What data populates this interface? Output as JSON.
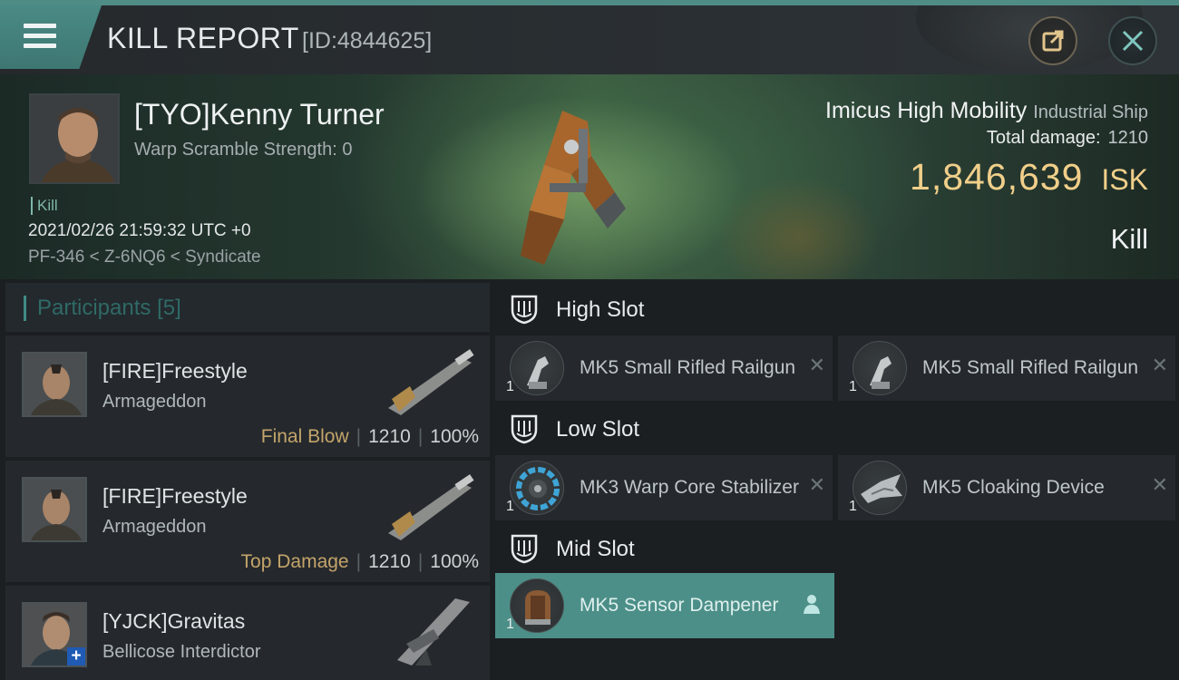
{
  "header": {
    "title": "KILL REPORT",
    "report_id": "[ID:4844625]"
  },
  "victim": {
    "name": "[TYO]Kenny Turner",
    "warp_scramble": "Warp Scramble Strength: 0",
    "tag": "Kill",
    "timestamp": "2021/02/26 21:59:32 UTC +0",
    "location": "PF-346 < Z-6NQ6 < Syndicate"
  },
  "ship": {
    "name": "Imicus High Mobility",
    "class": "Industrial Ship",
    "total_damage_label": "Total damage:",
    "total_damage": "1210",
    "isk_value": "1,846,639",
    "isk_unit": "ISK",
    "result": "Kill"
  },
  "participants": {
    "label": "Participants",
    "count": "[5]",
    "items": [
      {
        "name": "[FIRE]Freestyle",
        "ship": "Armageddon",
        "tag": "Final Blow",
        "damage": "1210",
        "percent": "100%"
      },
      {
        "name": "[FIRE]Freestyle",
        "ship": "Armageddon",
        "tag": "Top Damage",
        "damage": "1210",
        "percent": "100%"
      },
      {
        "name": "[YJCK]Gravitas",
        "ship": "Bellicose Interdictor",
        "tag": "",
        "damage": "",
        "percent": ""
      }
    ]
  },
  "slots": {
    "high": {
      "label": "High Slot",
      "modules": [
        {
          "name": "MK5 Small Rifled Railgun",
          "qty": "1",
          "icon": "railgun-icon"
        },
        {
          "name": "MK5 Small Rifled Railgun",
          "qty": "1",
          "icon": "railgun-icon"
        }
      ]
    },
    "low": {
      "label": "Low Slot",
      "modules": [
        {
          "name": "MK3 Warp Core Stabilizer",
          "qty": "1",
          "icon": "warp-core-stabilizer-icon"
        },
        {
          "name": "MK5 Cloaking Device",
          "qty": "1",
          "icon": "cloaking-device-icon"
        }
      ]
    },
    "mid": {
      "label": "Mid Slot",
      "modules": [
        {
          "name": "MK5 Sensor Dampener",
          "qty": "1",
          "icon": "sensor-dampener-icon"
        }
      ]
    }
  },
  "colors": {
    "accent": "#4c8f88",
    "isk": "#f0cf8a",
    "tag": "#c4a46a"
  }
}
